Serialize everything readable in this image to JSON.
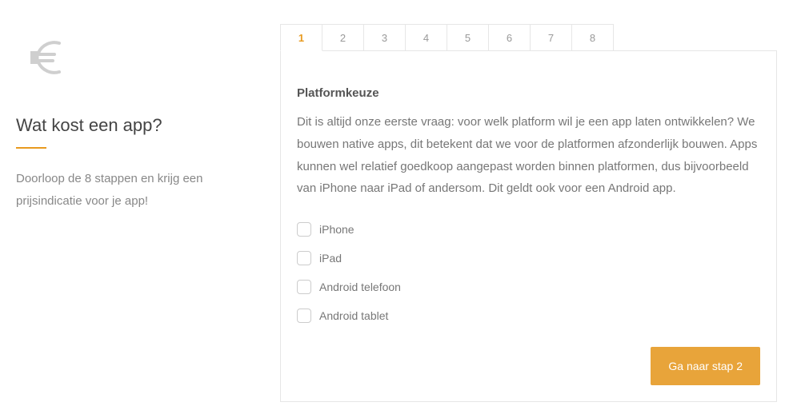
{
  "sidebar": {
    "title": "Wat kost een app?",
    "description": "Doorloop de 8 stappen en krijg een prijsindicatie voor je app!"
  },
  "tabs": [
    {
      "label": "1",
      "active": true
    },
    {
      "label": "2",
      "active": false
    },
    {
      "label": "3",
      "active": false
    },
    {
      "label": "4",
      "active": false
    },
    {
      "label": "5",
      "active": false
    },
    {
      "label": "6",
      "active": false
    },
    {
      "label": "7",
      "active": false
    },
    {
      "label": "8",
      "active": false
    }
  ],
  "panel": {
    "title": "Platformkeuze",
    "text": "Dit is altijd onze eerste vraag: voor welk platform wil je een app laten ontwikkelen? We bouwen native apps, dit betekent dat we voor de platformen afzonderlijk bouwen. Apps kunnen wel relatief goedkoop aangepast worden binnen platformen, dus bijvoorbeeld van iPhone naar iPad of andersom. Dit geldt ook voor een Android app.",
    "options": [
      {
        "label": "iPhone"
      },
      {
        "label": "iPad"
      },
      {
        "label": "Android telefoon"
      },
      {
        "label": "Android tablet"
      }
    ],
    "next_button": "Ga naar stap 2"
  },
  "colors": {
    "accent": "#e89a1f",
    "button": "#e8a43a"
  }
}
